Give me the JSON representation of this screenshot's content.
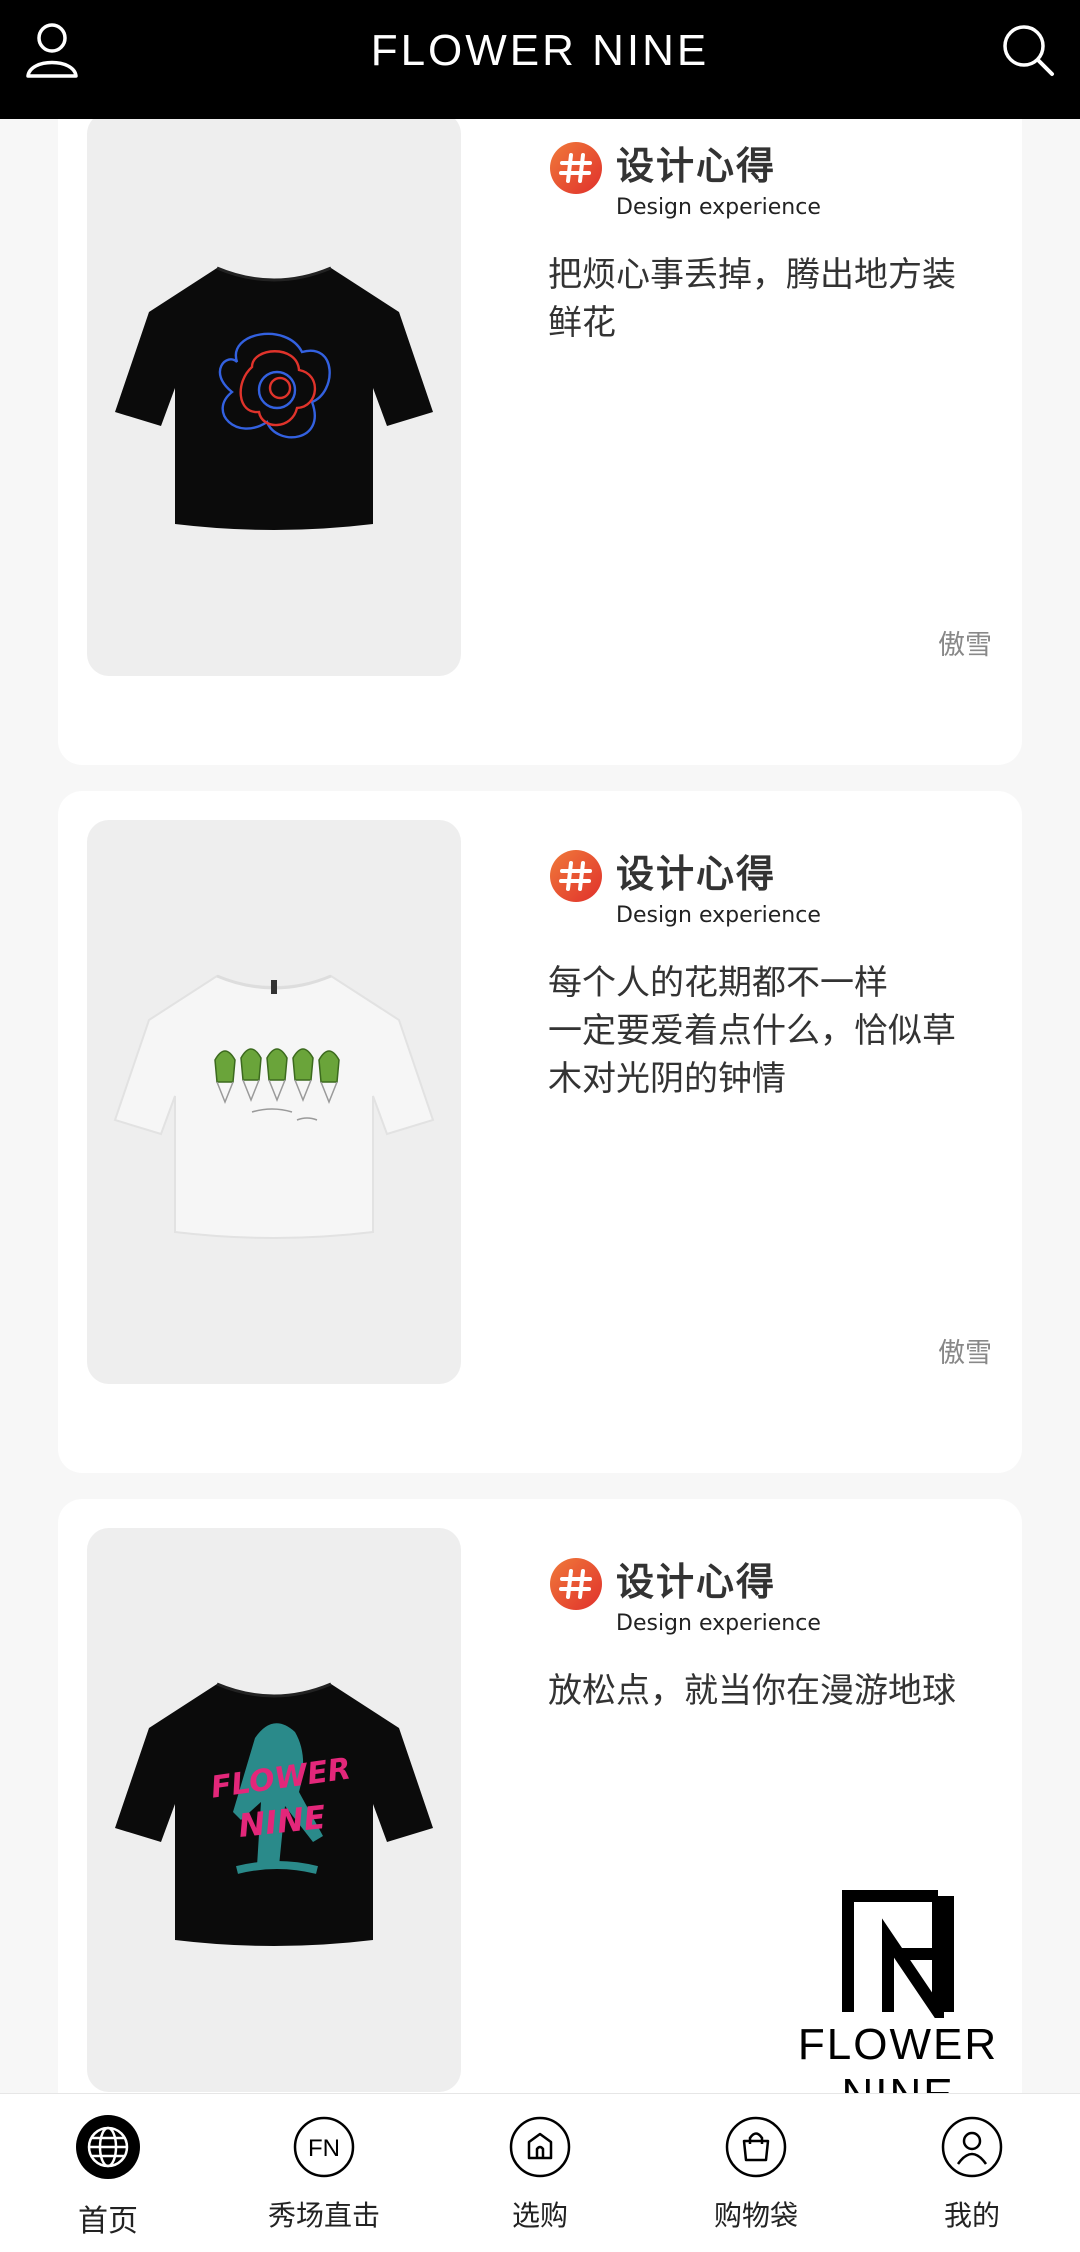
{
  "header": {
    "brand": "FLOWER NINE",
    "user_icon": "user-icon",
    "search_icon": "search-icon"
  },
  "cards": [
    {
      "tag_title": "设计心得",
      "tag_subtitle": "Design experience",
      "description": "把烦心事丢掉，腾出地方装鲜花",
      "author": "傲雪",
      "shirt_color": "#0a0a0a",
      "print": "red-blue flower outline"
    },
    {
      "tag_title": "设计心得",
      "tag_subtitle": "Design experience",
      "description": "每个人的花期都不一样\n一定要爱着点什么，恰似草木对光阴的钟情",
      "author": "傲雪",
      "shirt_color": "#f4f4f4",
      "print": "green tulips with FLOWER NINE script"
    },
    {
      "tag_title": "设计心得",
      "tag_subtitle": "Design experience",
      "description": "放松点，就当你在漫游地球",
      "author": "",
      "shirt_color": "#0a0a0a",
      "print": "teal skater with pink FLOWER NINE"
    }
  ],
  "watermark": {
    "logo_text": "FLOWER NINE"
  },
  "tabbar": {
    "items": [
      {
        "label": "首页",
        "icon": "globe-icon",
        "active": true
      },
      {
        "label": "秀场直击",
        "icon": "fn-badge-icon",
        "active": false
      },
      {
        "label": "选购",
        "icon": "shop-icon",
        "active": false
      },
      {
        "label": "购物袋",
        "icon": "bag-icon",
        "active": false
      },
      {
        "label": "我的",
        "icon": "profile-icon",
        "active": false
      }
    ]
  },
  "colors": {
    "accent": "#e8452c",
    "header_bg": "#000000",
    "page_bg": "#f7f7f7"
  }
}
